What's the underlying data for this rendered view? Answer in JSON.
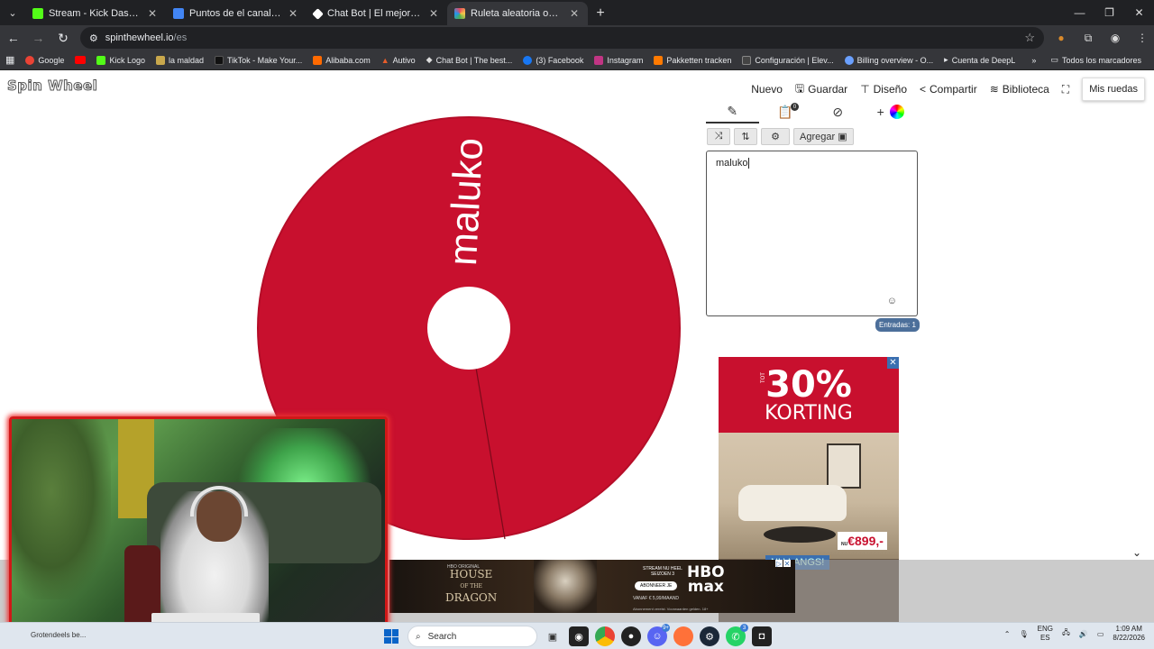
{
  "tabs": [
    {
      "title": "Stream - Kick Dashboard",
      "color": "#53fc18",
      "active": false
    },
    {
      "title": "Puntos de el canal. - Document",
      "color": "#4285f4",
      "active": false
    },
    {
      "title": "Chat Bot | El mejor software pa",
      "color": "#ffffff",
      "active": false
    },
    {
      "title": "Ruleta aleatoria online – ruleta",
      "color": "#e84a5f",
      "active": true
    }
  ],
  "address": {
    "domain": "spinthewheel.io",
    "path": "/es"
  },
  "bookmarks": [
    {
      "label": "Google",
      "color": "#ea4335"
    },
    {
      "label": "",
      "color": "#ff0000"
    },
    {
      "label": "Kick Logo",
      "color": "#53fc18"
    },
    {
      "label": "la maldad",
      "color": "#c9a84c"
    },
    {
      "label": "TikTok - Make Your...",
      "color": "#111111"
    },
    {
      "label": "Alibaba.com",
      "color": "#ff6a00"
    },
    {
      "label": "Autivo",
      "color": "#e85d2a"
    },
    {
      "label": "Chat Bot | The best...",
      "color": "#dddddd"
    },
    {
      "label": "(3) Facebook",
      "color": "#1877f2"
    },
    {
      "label": "Instagram",
      "color": "#c13584"
    },
    {
      "label": "Pakketten tracken",
      "color": "#ff7a00"
    },
    {
      "label": "Configuración | Elev...",
      "color": "#444444"
    },
    {
      "label": "Billing overview - O...",
      "color": "#6aa0ff"
    },
    {
      "label": "Cuenta de DeepL",
      "color": "#0f2b46"
    }
  ],
  "bookmarks_all": "Todos los marcadores",
  "site": {
    "logo": "Spin Wheel",
    "nav": {
      "nuevo": "Nuevo",
      "guardar": "Guardar",
      "diseno": "Diseño",
      "compartir": "Compartir",
      "biblioteca": "Biblioteca",
      "mis_ruedas": "Mis ruedas"
    }
  },
  "wheel": {
    "color": "#c8102e",
    "entry": "maluko"
  },
  "editor": {
    "add_label": "Agregar",
    "results_badge": "0",
    "entries_text": "maluko",
    "entries_count": "Entradas: 1"
  },
  "ad": {
    "percent": "30%",
    "small": "TOT",
    "korting": "KORTING",
    "price": "€899,-",
    "price_prefix": "NU",
    "cta": "NU LANGS!"
  },
  "hbo_ad": {
    "sub": "HBO ORIGINAL",
    "title_line1": "HOUSE",
    "title_line2": "DRAGON",
    "title_of": "OF THE",
    "stream_text": "STREAM NU HEEL SEIZOEN 3",
    "logo_line1": "HBO",
    "logo_line2": "max",
    "button": "ABONNEER JE",
    "price": "VANAF € 5,99/MAAND",
    "legal": "Abonnement vereist. Voorwaarden gelden. 18+"
  },
  "taskbar": {
    "status_text": "Grotendeels be...",
    "search_placeholder": "Search",
    "lang_top": "ENG",
    "lang_bottom": "ES",
    "time": "1:09 AM",
    "date": "8/22/2026",
    "discord_count": "9+",
    "whatsapp_count": "3"
  }
}
